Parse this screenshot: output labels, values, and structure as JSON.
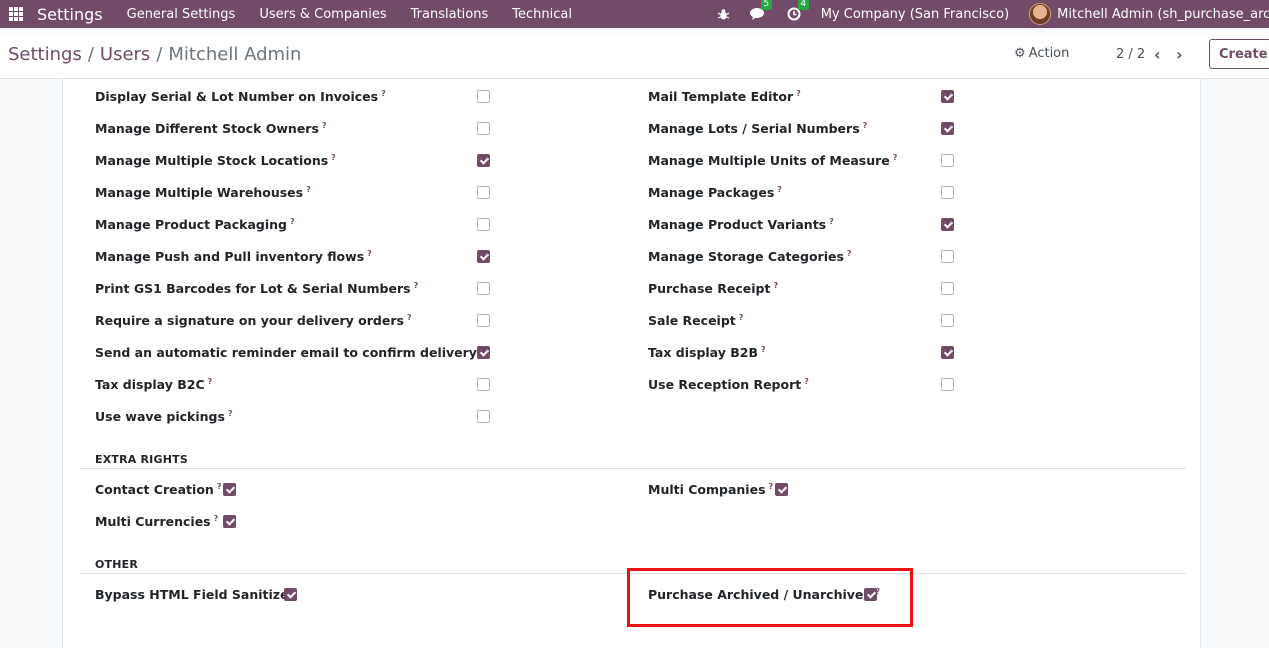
{
  "navbar": {
    "brand": "Settings",
    "menu": [
      "General Settings",
      "Users & Companies",
      "Translations",
      "Technical"
    ],
    "messages_count": "5",
    "activities_count": "4",
    "company": "My Company (San Francisco)",
    "user": "Mitchell Admin (sh_purchase_archive_Adv"
  },
  "breadcrumb": {
    "items": [
      "Settings",
      "Users"
    ],
    "current": "Mitchell Admin",
    "separator": "/"
  },
  "control": {
    "action_label": "Action",
    "pager": "2 / 2",
    "create_label": "Create"
  },
  "technical_left": [
    {
      "label": "Display Serial & Lot Number on Invoices",
      "checked": false
    },
    {
      "label": "Manage Different Stock Owners",
      "checked": false
    },
    {
      "label": "Manage Multiple Stock Locations",
      "checked": true
    },
    {
      "label": "Manage Multiple Warehouses",
      "checked": false
    },
    {
      "label": "Manage Product Packaging",
      "checked": false
    },
    {
      "label": "Manage Push and Pull inventory flows",
      "checked": true
    },
    {
      "label": "Print GS1 Barcodes for Lot & Serial Numbers",
      "checked": false
    },
    {
      "label": "Require a signature on your delivery orders",
      "checked": false
    },
    {
      "label": "Send an automatic reminder email to confirm delivery",
      "checked": true
    },
    {
      "label": "Tax display B2C",
      "checked": false
    },
    {
      "label": "Use wave pickings",
      "checked": false
    }
  ],
  "technical_right": [
    {
      "label": "Mail Template Editor",
      "checked": true
    },
    {
      "label": "Manage Lots / Serial Numbers",
      "checked": true
    },
    {
      "label": "Manage Multiple Units of Measure",
      "checked": false
    },
    {
      "label": "Manage Packages",
      "checked": false
    },
    {
      "label": "Manage Product Variants",
      "checked": true
    },
    {
      "label": "Manage Storage Categories",
      "checked": false
    },
    {
      "label": "Purchase Receipt",
      "checked": false
    },
    {
      "label": "Sale Receipt",
      "checked": false
    },
    {
      "label": "Tax display B2B",
      "checked": true
    },
    {
      "label": "Use Reception Report",
      "checked": false
    }
  ],
  "extra_rights": {
    "title": "EXTRA RIGHTS",
    "items": [
      {
        "label": "Contact Creation",
        "checked": true
      },
      {
        "label": "Multi Currencies",
        "checked": true
      },
      {
        "label": "Multi Companies",
        "checked": true
      }
    ]
  },
  "other": {
    "title": "OTHER",
    "items": [
      {
        "label": "Bypass HTML Field Sanitize",
        "checked": true
      },
      {
        "label": "Purchase Archived / Unarchived",
        "checked": true
      }
    ]
  },
  "help_mark": "?",
  "colors": {
    "brand": "#714b67",
    "highlight": "#e81414",
    "badge": "#28a745"
  }
}
